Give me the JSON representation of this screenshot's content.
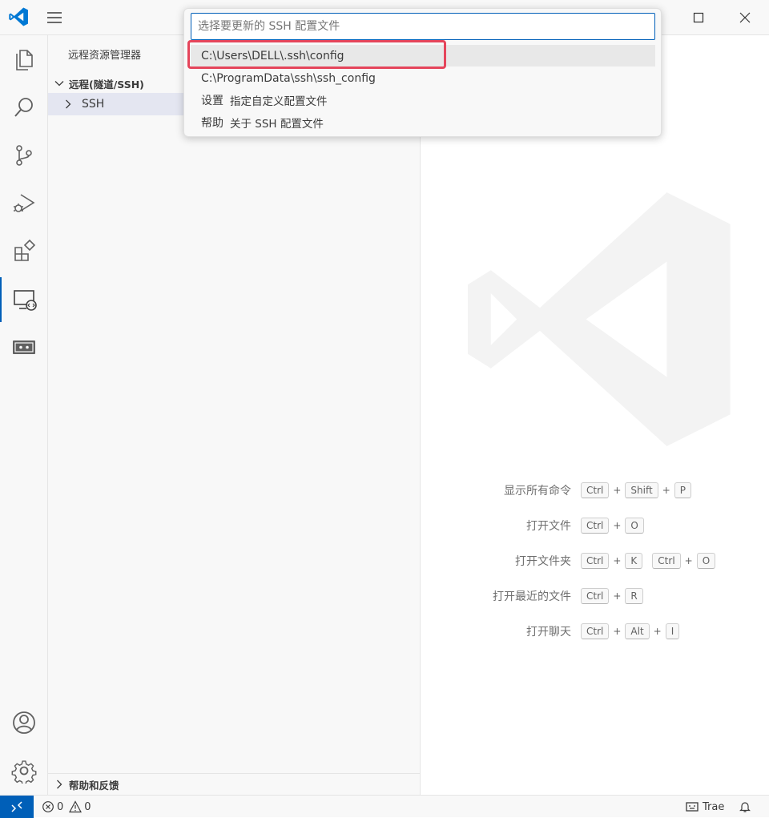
{
  "sidebar": {
    "title": "远程资源管理器",
    "section": "远程(隧道/SSH)",
    "tree_item": "SSH",
    "help": "帮助和反馈"
  },
  "quick_pick": {
    "placeholder": "选择要更新的 SSH 配置文件",
    "items": [
      {
        "label": "C:\\Users\\DELL\\.ssh\\config",
        "desc": ""
      },
      {
        "label": "C:\\ProgramData\\ssh\\ssh_config",
        "desc": ""
      },
      {
        "label": "设置",
        "desc": "指定自定义配置文件"
      },
      {
        "label": "帮助",
        "desc": "关于 SSH 配置文件"
      }
    ]
  },
  "shortcuts": [
    {
      "label": "显示所有命令",
      "keys": [
        [
          "Ctrl",
          "Shift",
          "P"
        ]
      ]
    },
    {
      "label": "打开文件",
      "keys": [
        [
          "Ctrl",
          "O"
        ]
      ]
    },
    {
      "label": "打开文件夹",
      "keys": [
        [
          "Ctrl",
          "K"
        ],
        [
          "Ctrl",
          "O"
        ]
      ]
    },
    {
      "label": "打开最近的文件",
      "keys": [
        [
          "Ctrl",
          "R"
        ]
      ]
    },
    {
      "label": "打开聊天",
      "keys": [
        [
          "Ctrl",
          "Alt",
          "I"
        ]
      ]
    }
  ],
  "status": {
    "errors": "0",
    "warnings": "0",
    "trae": "Trae"
  },
  "colors": {
    "accent": "#005fb8",
    "highlight": "#e5455b"
  }
}
